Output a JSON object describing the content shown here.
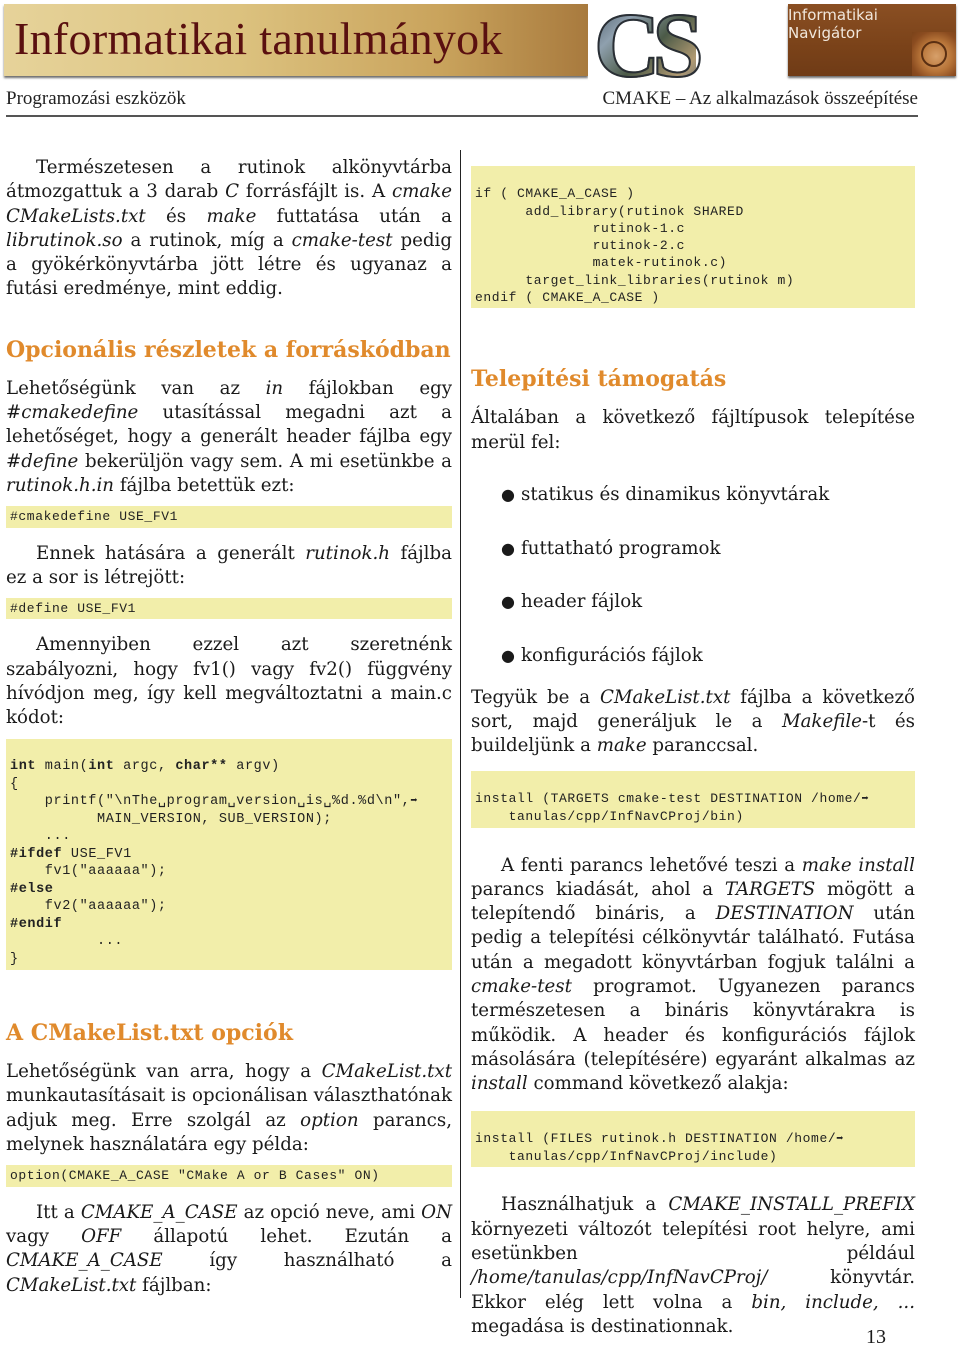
{
  "banner": {
    "title": "Informatikai tanulmányok",
    "logo_text": "CS",
    "magazine": "Informatikai Navigátor",
    "colors": {
      "title": "#5a1010",
      "gold": "#dcc27f",
      "brown": "#7a4219"
    }
  },
  "running_head": {
    "left": "Programozási eszközök",
    "right": "CMAKE – Az alkalmazások összeépítése"
  },
  "left_column": {
    "intro_paragraph": {
      "parts": [
        "Természetesen a rutinok alkönyvtárba átmozgattuk a 3 darab ",
        "C",
        " forrásfájlt is. A ",
        "cmake CMakeLists.txt",
        " és ",
        "make",
        " futtatása után a ",
        "librutinok.so",
        " a rutinok, míg a ",
        "cmake-test",
        " pedig a gyökérkönyvtárba jött létre és ugyanaz a futási eredménye, mint eddig."
      ]
    },
    "section1": {
      "heading": "Opcionális részletek a forráskódban",
      "paragraph1": {
        "parts": [
          "Lehetőségünk van az ",
          "in",
          " fájlokban egy ",
          "#cmakedefine",
          " utasítással megadni azt a lehetőséget, hogy a generált header fájlba egy ",
          "#define",
          " bekerüljön vagy sem. A mi esetünkbe a ",
          "rutinok.h.in",
          " fájlba betettük ezt:"
        ]
      },
      "code1": "#cmakedefine USE_FV1",
      "paragraph2": {
        "parts": [
          "Ennek hatására a generált ",
          "rutinok.h",
          " fájlba ez a sor is létrejött:"
        ]
      },
      "code2": "#define USE_FV1",
      "paragraph3": "Amennyiben ezzel azt szeretnénk szabályozni, hogy fv1() vagy fv2() függvény hívódjon meg, így kell megváltoztatni a main.c kódot:",
      "code3_lines": [
        [
          "int",
          " main(",
          "int",
          " argc, ",
          "char**",
          " argv)"
        ],
        [
          "{"
        ],
        [
          "    printf(\"\\nThe␣program␣version␣is␣%d.%d\\n\",",
          "➡"
        ],
        [
          "          MAIN_VERSION, SUB_VERSION);"
        ],
        [
          "    ..."
        ],
        [
          "#ifdef",
          " USE_FV1"
        ],
        [
          "    fv1(\"aaaaaa\");"
        ],
        [
          "#else"
        ],
        [
          "    fv2(\"aaaaaa\");"
        ],
        [
          "#endif"
        ],
        [
          "          ..."
        ],
        [
          "}"
        ]
      ]
    },
    "section2": {
      "heading": "A CMakeList.txt opciók",
      "paragraph1": {
        "parts": [
          "Lehetőségünk van arra, hogy a ",
          "CMakeList.txt",
          " munkautasításait is opcionálisan választhatónak adjuk meg. Erre szolgál az ",
          "option",
          " parancs, melynek használatára egy példa:"
        ]
      },
      "code1": "option(CMAKE_A_CASE \"CMake A or B Cases\" ON)",
      "paragraph2": {
        "parts": [
          "Itt a ",
          "CMAKE_A_CASE",
          " az opció neve, ami ",
          "ON",
          " vagy ",
          "OFF",
          " állapotú lehet. Ezután a ",
          "CMAKE_A_CASE",
          " így használható a ",
          "CMakeList.txt",
          " fájlban:"
        ]
      }
    }
  },
  "right_column": {
    "code_top_lines": [
      "if ( CMAKE_A_CASE )",
      "      add_library(rutinok SHARED",
      "              rutinok-1.c",
      "              rutinok-2.c",
      "              matek-rutinok.c)",
      "      target_link_libraries(rutinok m)",
      "endif ( CMAKE_A_CASE )"
    ],
    "section3": {
      "heading": "Telepítési támogatás",
      "intro": "Általában a következő fájltípusok telepítése merül fel:",
      "bullets": [
        "statikus és dinamikus könyvtárak",
        "futtatható programok",
        "header fájlok",
        "konfigurációs fájlok"
      ],
      "paragraph1": {
        "parts": [
          "Tegyük be a ",
          "CMakeList.txt",
          " fájlba a következő sort, majd generáljuk le a ",
          "Makefile",
          "-t és buildeljünk a ",
          "make",
          " paranccsal."
        ]
      },
      "code1_lines": [
        "install (TARGETS cmake-test DESTINATION /home/",
        "    tanulas/cpp/InfNavCProj/bin)"
      ],
      "paragraph2": {
        "parts": [
          "A fenti parancs lehetővé teszi a ",
          "make install",
          " parancs kiadását, ahol a ",
          "TARGETS",
          " mögött a telepítendő bináris, a ",
          "DESTINATION",
          " után pedig a telepítési célkönyvtár található. Futása után a megadott könyvtárban fogjuk találni a ",
          "cmake-test",
          " programot. Ugyanezen parancs természetesen a bináris könyvtárakra is működik. A header és konfigurációs fájlok másolására (telepítésére) egyaránt alkalmas az ",
          "install",
          " command következő alakja:"
        ]
      },
      "code2_lines": [
        "install (FILES rutinok.h DESTINATION /home/",
        "    tanulas/cpp/InfNavCProj/include)"
      ],
      "paragraph3": {
        "parts": [
          "Használhatjuk a ",
          "CMAKE_INSTALL_PREFIX",
          " környezeti változót telepítési root helyre, ami esetünkben például ",
          "/home/tanulas/cpp/InfNavCProj/",
          " könyvtár. Ekkor elég lett volna a ",
          "bin, include, ...",
          " megadása is destinationnak."
        ]
      }
    },
    "code_continuation_icon": "arrow-right-icon",
    "code_background": "#f2eeaa",
    "heading_color": "#e08a2c"
  },
  "page_number": "13"
}
